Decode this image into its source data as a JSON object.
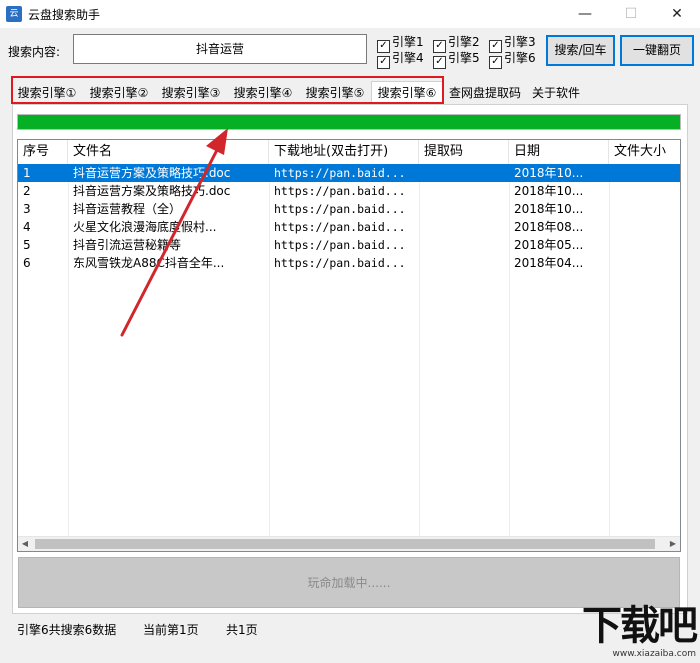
{
  "window": {
    "title": "云盘搜索助手",
    "icon": "cloud-app-icon",
    "buttons": [
      "minimize",
      "maximize",
      "close"
    ]
  },
  "search": {
    "label": "搜索内容:",
    "value": "抖音运营"
  },
  "engines": [
    {
      "label": "引擎1",
      "checked": true
    },
    {
      "label": "引擎2",
      "checked": true
    },
    {
      "label": "引擎3",
      "checked": true
    },
    {
      "label": "引擎4",
      "checked": true
    },
    {
      "label": "引擎5",
      "checked": true
    },
    {
      "label": "引擎6",
      "checked": true
    }
  ],
  "actions": {
    "search_button": "搜索/回车",
    "page_button": "一键翻页"
  },
  "tabs": [
    {
      "label": "搜索引擎①",
      "active": false
    },
    {
      "label": "搜索引擎②",
      "active": false
    },
    {
      "label": "搜索引擎③",
      "active": false
    },
    {
      "label": "搜索引擎④",
      "active": false
    },
    {
      "label": "搜索引擎⑤",
      "active": false
    },
    {
      "label": "搜索引擎⑥",
      "active": true
    },
    {
      "label": "查网盘提取码",
      "active": false
    },
    {
      "label": "关于软件",
      "active": false
    }
  ],
  "progress": {
    "value": 1.0,
    "color": "#06b025"
  },
  "table": {
    "columns": [
      "序号",
      "文件名",
      "下载地址(双击打开)",
      "提取码",
      "日期",
      "文件大小"
    ],
    "rows": [
      {
        "no": "1",
        "name": "抖音运营方案及策略技巧.doc",
        "url": "https://pan.baid...",
        "code": "",
        "date": "2018年10...",
        "size": "",
        "selected": true
      },
      {
        "no": "2",
        "name": "抖音运营方案及策略技巧.doc",
        "url": "https://pan.baid...",
        "code": "",
        "date": "2018年10...",
        "size": ""
      },
      {
        "no": "3",
        "name": "抖音运营教程（全）",
        "url": "https://pan.baid...",
        "code": "",
        "date": "2018年10...",
        "size": ""
      },
      {
        "no": "4",
        "name": "火星文化浪漫海底度假村...",
        "url": "https://pan.baid...",
        "code": "",
        "date": "2018年08...",
        "size": ""
      },
      {
        "no": "5",
        "name": "抖音引流运营秘籍等",
        "url": "https://pan.baid...",
        "code": "",
        "date": "2018年05...",
        "size": ""
      },
      {
        "no": "6",
        "name": "东风雪铁龙A88C抖音全年...",
        "url": "https://pan.baid...",
        "code": "",
        "date": "2018年04...",
        "size": ""
      }
    ]
  },
  "loading_text": "玩命加载中......",
  "status": {
    "engine_info": "引擎6共搜索6数据",
    "current_page": "当前第1页",
    "total_pages": "共1页"
  },
  "watermark": {
    "text": "下载吧",
    "url": "www.xiazaiba.com"
  },
  "colors": {
    "selection": "#0078d7",
    "highlight_box": "#e0191f",
    "arrow": "#d0262c"
  }
}
